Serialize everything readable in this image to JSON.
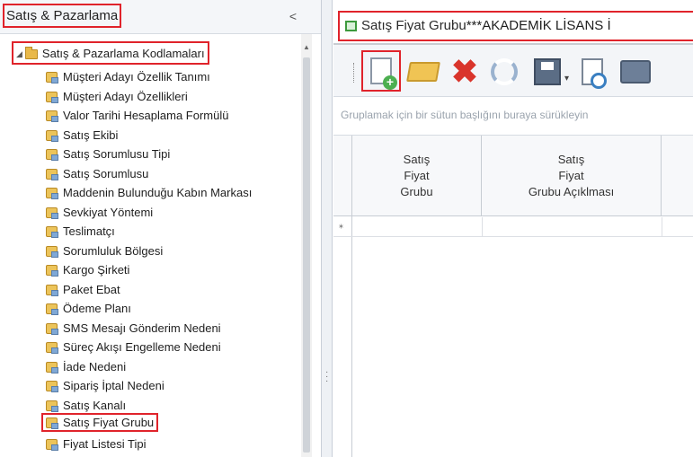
{
  "left_panel": {
    "title": "Satış & Pazarlama",
    "collapse_glyph": "<",
    "tree_root": {
      "label": "Satış & Pazarlama Kodlamaları",
      "expand_glyph": "◢",
      "icon": "folder-icon"
    },
    "items": [
      {
        "label": "Müşteri Adayı Özellik Tanımı"
      },
      {
        "label": "Müşteri Adayı Özellikleri"
      },
      {
        "label": "Valor Tarihi Hesaplama Formülü"
      },
      {
        "label": "Satış Ekibi"
      },
      {
        "label": "Satış Sorumlusu Tipi"
      },
      {
        "label": "Satış Sorumlusu"
      },
      {
        "label": "Maddenin Bulunduğu Kabın Markası"
      },
      {
        "label": "Sevkiyat Yöntemi"
      },
      {
        "label": "Teslimatçı"
      },
      {
        "label": "Sorumluluk Bölgesi"
      },
      {
        "label": "Kargo Şirketi"
      },
      {
        "label": "Paket Ebat"
      },
      {
        "label": "Ödeme Planı"
      },
      {
        "label": "SMS Mesajı Gönderim Nedeni"
      },
      {
        "label": "Süreç Akışı Engelleme Nedeni"
      },
      {
        "label": "İade Nedeni"
      },
      {
        "label": "Sipariş İptal Nedeni"
      },
      {
        "label": "Satış Kanalı"
      },
      {
        "label": "Satış Fiyat Grubu",
        "selected": true
      },
      {
        "label": "Fiyat Listesi Tipi"
      }
    ]
  },
  "right_panel": {
    "tab": {
      "name": "Satış Fiyat Grubu",
      "suffix": "***AKADEMİK LİSANS İ",
      "icon": "form-icon"
    },
    "toolbar": {
      "buttons": [
        {
          "name": "new-record-icon",
          "highlighted": true
        },
        {
          "name": "open-folder-icon"
        },
        {
          "name": "delete-icon",
          "glyph": "✖"
        },
        {
          "name": "refresh-icon"
        },
        {
          "name": "save-icon",
          "caret": "▾"
        },
        {
          "name": "print-preview-icon"
        },
        {
          "name": "print-icon"
        }
      ]
    },
    "group_hint": "Gruplamak için bir sütun başlığını buraya sürükleyin",
    "grid": {
      "columns": [
        {
          "header": "Satış\nFiyat\nGrubu"
        },
        {
          "header": "Satış\nFiyat\nGrubu Açıklması"
        },
        {
          "header": ""
        }
      ],
      "new_row_marker": "⁎"
    }
  },
  "colors": {
    "highlight": "#e0232b",
    "panel_bg": "#f3f5f8",
    "grid_line": "#c7ccd3",
    "hint_text": "#9aa3ad"
  }
}
